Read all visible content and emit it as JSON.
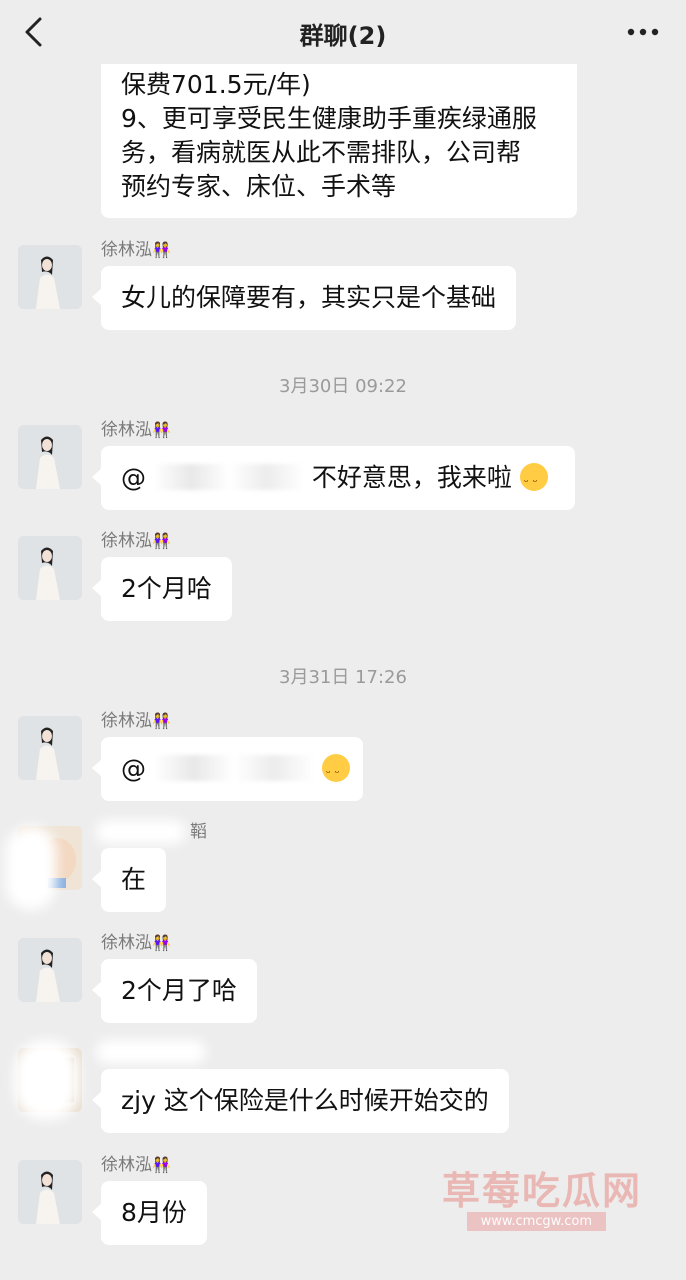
{
  "header": {
    "title": "群聊(2)",
    "back_icon": "chevron-left-icon",
    "more_icon": "more-dots-icon"
  },
  "messages": [
    {
      "lines": [
        "保费701.5元/年)",
        "9、更可享受民生健康助手重疾绿通服",
        "务，看病就医从此不需排队，公司帮",
        "预约专家、床位、手术等"
      ]
    },
    {
      "sender": "徐林泓",
      "sender_emoji": "👭",
      "text": "女儿的保障要有，其实只是个基础"
    },
    {
      "timestamp": "3月30日 09:22"
    },
    {
      "sender": "徐林泓",
      "sender_emoji": "👭",
      "text_prefix": "@",
      "text": "不好意思，我来啦",
      "emoji": "smile-icon"
    },
    {
      "sender": "徐林泓",
      "sender_emoji": "👭",
      "text": "2个月哈"
    },
    {
      "timestamp": "3月31日 17:26"
    },
    {
      "sender": "徐林泓",
      "sender_emoji": "👭",
      "text_prefix": "@",
      "emoji": "smile-icon"
    },
    {
      "sender": "鞱",
      "text": "在"
    },
    {
      "sender": "徐林泓",
      "sender_emoji": "👭",
      "text": "2个月了哈"
    },
    {
      "text": "zjy 这个保险是什么时候开始交的"
    },
    {
      "sender": "徐林泓",
      "sender_emoji": "👭",
      "text": "8月份"
    }
  ],
  "watermark": {
    "text": "草莓吃瓜网",
    "url": "www.cmcgw.com"
  }
}
